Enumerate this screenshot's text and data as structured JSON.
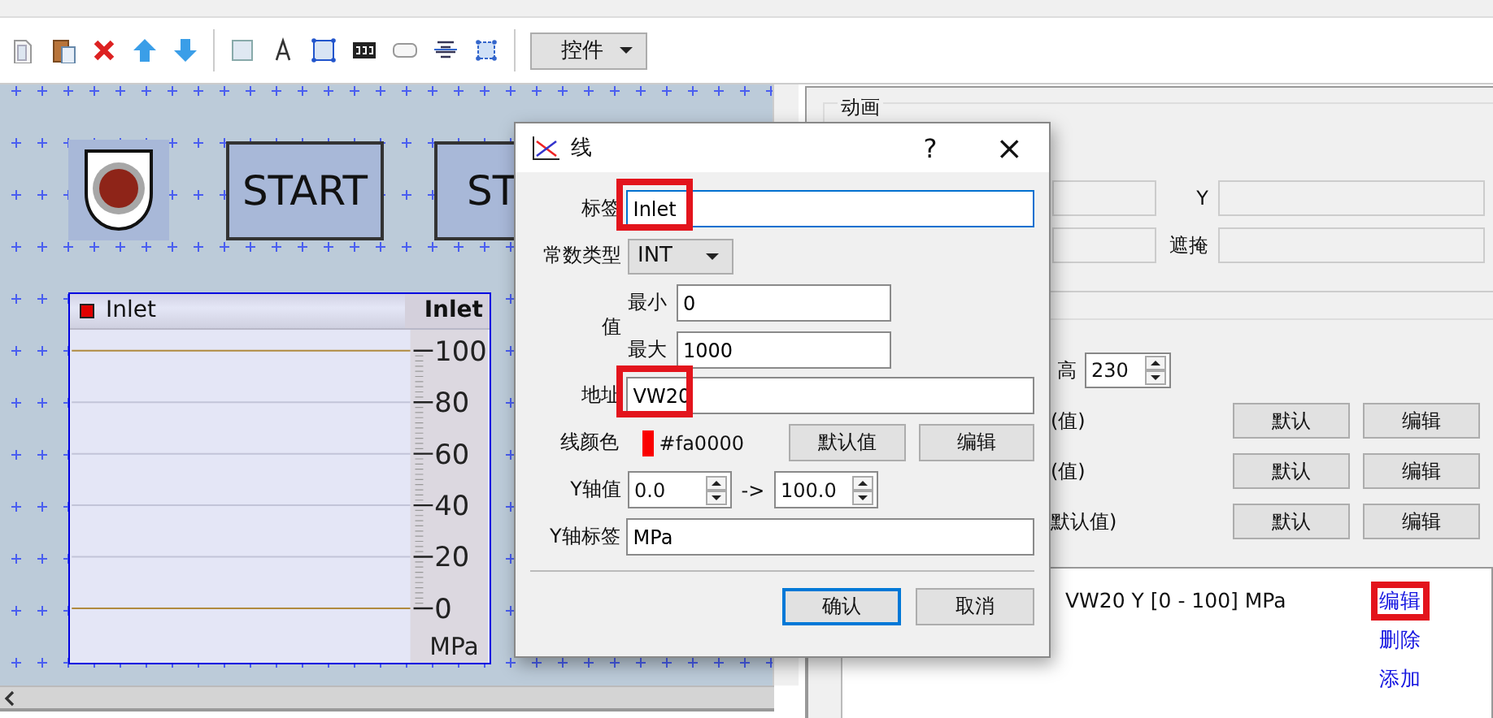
{
  "toolbar": {
    "dropdown": "控件"
  },
  "canvas": {
    "buttons": [
      "START",
      "ST"
    ],
    "trend": {
      "chart_data": {
        "type": "line",
        "grid": true,
        "title": "Inlet",
        "ylabel": "MPa",
        "ylim": [
          0,
          100
        ],
        "yticks": [
          0,
          20,
          40,
          60,
          80,
          100
        ],
        "series": [
          {
            "name": "Inlet",
            "color": "#e00000"
          }
        ]
      }
    }
  },
  "dialog": {
    "title": "线",
    "help": "?",
    "close": "×",
    "tag": {
      "label": "标签",
      "value": "Inlet",
      "highlighted": true
    },
    "type": {
      "label": "常数类型",
      "value": "INT"
    },
    "range": {
      "label": "值",
      "min_label": "最小",
      "min": "0",
      "max_label": "最大",
      "max": "1000"
    },
    "address": {
      "label": "地址",
      "value": "VW20",
      "highlighted": true
    },
    "line_color": {
      "label": "线颜色",
      "color": "#fa0000",
      "text": "#fa0000",
      "buttons": [
        "默认值",
        "编辑"
      ]
    },
    "y_range": {
      "label": "Y轴值",
      "from": "0.0",
      "arrow": "->",
      "to": "100.0"
    },
    "y_label": {
      "label": "Y轴标签",
      "value": "MPa"
    },
    "buttons": [
      {
        "label": "确认",
        "default": true
      },
      {
        "label": "取消",
        "default": false
      }
    ]
  },
  "panel": {
    "group_title": "动画",
    "rows": [
      {
        "label": "Y"
      },
      {
        "label": "遮掩"
      }
    ],
    "height": {
      "label": "高",
      "value": "230"
    },
    "style_rows": [
      {
        "text": "(值)",
        "buttons": [
          "默认",
          "编辑"
        ]
      },
      {
        "text": "(值)",
        "buttons": [
          "默认",
          "编辑"
        ]
      },
      {
        "text": "默认值)",
        "buttons": [
          "默认",
          "编辑"
        ]
      }
    ],
    "list": {
      "entry": "VW20 Y [0 - 100] MPa",
      "links": [
        {
          "label": "编辑",
          "highlighted": true
        },
        {
          "label": "删除",
          "highlighted": false
        },
        {
          "label": "添加",
          "highlighted": false
        }
      ]
    }
  }
}
